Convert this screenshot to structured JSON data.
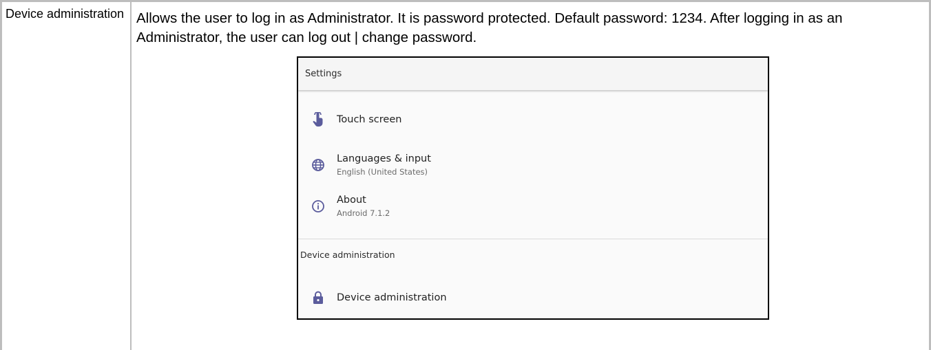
{
  "table": {
    "feature_name": "Device administration",
    "description": "Allows the user to log in as Administrator. It is password protected. Default password: 1234. After logging in as an Administrator, the user can log out | change password."
  },
  "settings_screen": {
    "title": "Settings",
    "items": [
      {
        "icon": "touch-hand-icon",
        "title": "Touch screen",
        "subtitle": ""
      },
      {
        "icon": "globe-icon",
        "title": "Languages & input",
        "subtitle": "English (United States)"
      },
      {
        "icon": "info-icon",
        "title": "About",
        "subtitle": "Android 7.1.2"
      }
    ],
    "section_header": "Device administration",
    "admin_item": {
      "icon": "lock-icon",
      "title": "Device administration"
    },
    "icon_color": "#5b5c9c"
  }
}
